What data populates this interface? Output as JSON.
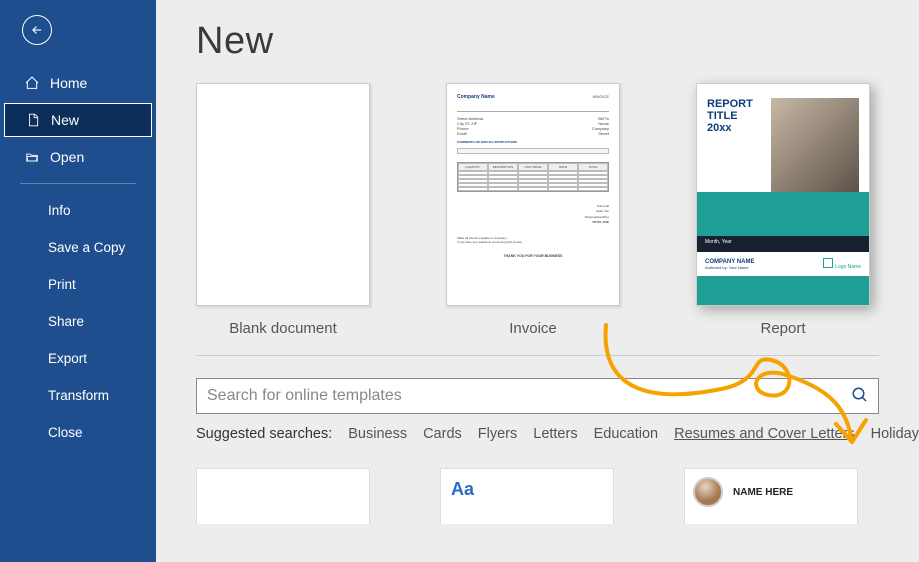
{
  "sidebar": {
    "primary": [
      {
        "label": "Home",
        "icon": "home"
      },
      {
        "label": "New",
        "icon": "doc",
        "selected": true
      },
      {
        "label": "Open",
        "icon": "folder"
      }
    ],
    "secondary": [
      {
        "label": "Info"
      },
      {
        "label": "Save a Copy"
      },
      {
        "label": "Print"
      },
      {
        "label": "Share"
      },
      {
        "label": "Export"
      },
      {
        "label": "Transform"
      },
      {
        "label": "Close"
      }
    ]
  },
  "page": {
    "title": "New"
  },
  "templates": [
    {
      "label": "Blank document"
    },
    {
      "label": "Invoice"
    },
    {
      "label": "Report"
    }
  ],
  "invoice_preview": {
    "company": "Company Name",
    "tag": "INVOICE",
    "headers": [
      "QUANTITY",
      "DESCRIPTION",
      "UNIT PRICE",
      "RATE",
      "TOTAL"
    ],
    "footer": "THANK YOU FOR YOUR BUSINESS"
  },
  "report_preview": {
    "title": "REPORT TITLE",
    "subtitle": "20xx",
    "company": "COMPANY NAME",
    "author": "Authored by: Your Name",
    "logo_text": "Logo Name"
  },
  "search": {
    "placeholder": "Search for online templates"
  },
  "suggested": {
    "label": "Suggested searches:",
    "items": [
      "Business",
      "Cards",
      "Flyers",
      "Letters",
      "Education",
      "Resumes and Cover Letters",
      "Holiday"
    ],
    "highlighted_index": 5
  },
  "row2_cards": {
    "aa": "Aa",
    "resume_name": "NAME HERE"
  }
}
